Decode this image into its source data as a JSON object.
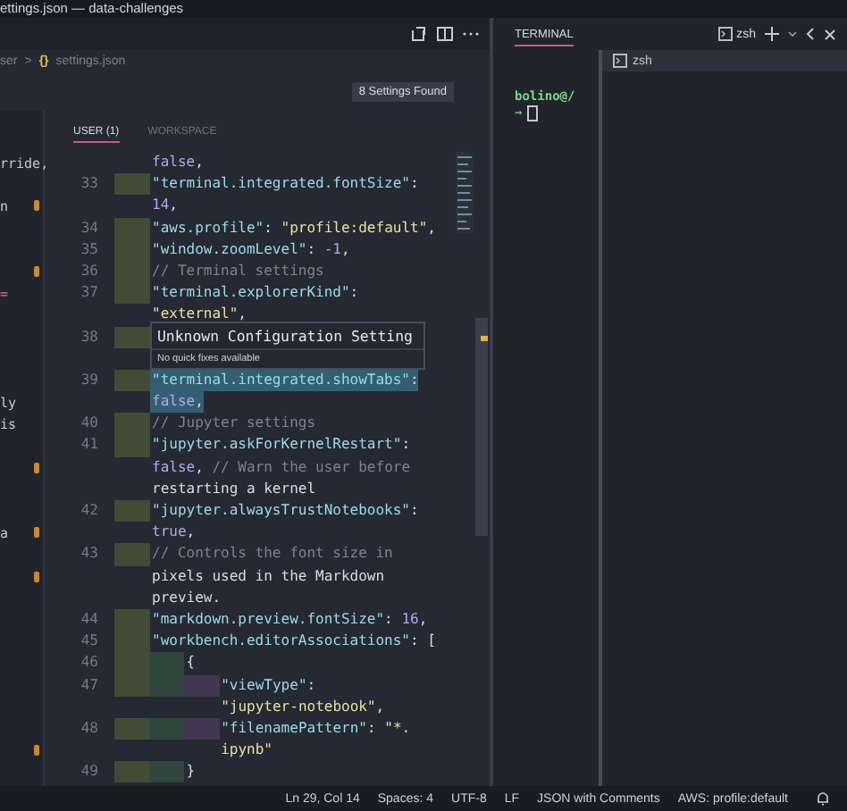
{
  "title_bar": {
    "title": "ettings.json — data-challenges"
  },
  "editor": {
    "breadcrumbs": {
      "folder": "ser",
      "separator": ">",
      "file_icon": "{}",
      "file": "settings.json"
    },
    "search_result": "8 Settings Found",
    "sidebar": [
      {
        "kind": "label",
        "text": "rride,",
        "modified": false
      },
      {
        "kind": "label",
        "text": "n",
        "modified": true
      },
      {
        "kind": "marker",
        "modified": true
      },
      {
        "kind": "operator",
        "text": "=",
        "modified": false
      },
      {
        "kind": "label",
        "text": "ly",
        "modified": false
      },
      {
        "kind": "label",
        "text": "is",
        "modified": false
      },
      {
        "kind": "marker",
        "modified": true
      },
      {
        "kind": "label",
        "text": "a",
        "modified": true
      },
      {
        "kind": "marker",
        "modified": true
      },
      {
        "kind": "marker",
        "modified": true
      }
    ],
    "scope_tabs": [
      {
        "label": "USER (1)",
        "selected": true
      },
      {
        "label": "WORKSPACE",
        "selected": false
      }
    ],
    "lines": [
      {
        "selected": false,
        "rows": [
          "false,"
        ]
      },
      {
        "number": "33",
        "selected": false,
        "rows": [
          "\"terminal.integrated.fontSize\":",
          "14,"
        ]
      },
      {
        "number": "34",
        "selected": false,
        "rows": [
          "\"aws.profile\": \"profile:default\","
        ]
      },
      {
        "number": "35",
        "selected": false,
        "rows": [
          "\"window.zoomLevel\": -1,"
        ]
      },
      {
        "number": "36",
        "selected": false,
        "rows": [
          "// Terminal settings"
        ]
      },
      {
        "number": "37",
        "selected": false,
        "rows": [
          "\"terminal.explorerKind\":",
          "\"external\","
        ]
      },
      {
        "number": "38",
        "selected": false,
        "hover": {
          "title": "Unknown Configuration Setting",
          "message": "No quick fixes available"
        }
      },
      {
        "number": "39",
        "selected": true,
        "rows": [
          "\"terminal.integrated.showTabs\":",
          "false,"
        ]
      },
      {
        "number": "40",
        "selected": false,
        "rows": [
          "// Jupyter settings"
        ]
      },
      {
        "number": "41",
        "selected": false,
        "rows": [
          "\"jupyter.askForKernelRestart\":",
          "false, // Warn the user before",
          "restarting a kernel"
        ]
      },
      {
        "number": "42",
        "selected": false,
        "rows": [
          "\"jupyter.alwaysTrustNotebooks\":",
          "true,"
        ]
      },
      {
        "number": "43",
        "selected": false,
        "rows": [
          "// Controls the font size in",
          "pixels used in the Markdown",
          "preview."
        ]
      },
      {
        "number": "44",
        "selected": false,
        "rows": [
          "\"markdown.preview.fontSize\": 16,"
        ]
      },
      {
        "number": "45",
        "selected": false,
        "rows": [
          "\"workbench.editorAssociations\": ["
        ],
        "children": [
          {
            "number": "46",
            "selected": false,
            "rows": [
              "{"
            ],
            "children": [
              {
                "number": "47",
                "selected": false,
                "rows": [
                  "\"viewType\":",
                  "\"jupyter-notebook\","
                ]
              },
              {
                "number": "48",
                "selected": false,
                "rows": [
                  "\"filenamePattern\": \"*.",
                  "ipynb\""
                ]
              }
            ]
          },
          {
            "number": "49",
            "selected": false,
            "rows": [
              "}"
            ]
          }
        ]
      }
    ]
  },
  "terminal": {
    "tab": "TERMINAL",
    "shell_button": "zsh",
    "shells": [
      {
        "label": "zsh",
        "selected": true
      }
    ],
    "prompt_user": "bolino@/",
    "prompt_arrow": "→"
  },
  "status_bar": [
    "Ln 29, Col 14",
    "Spaces: 4",
    "UTF-8",
    "LF",
    "JSON with Comments",
    "AWS: profile:default"
  ]
}
